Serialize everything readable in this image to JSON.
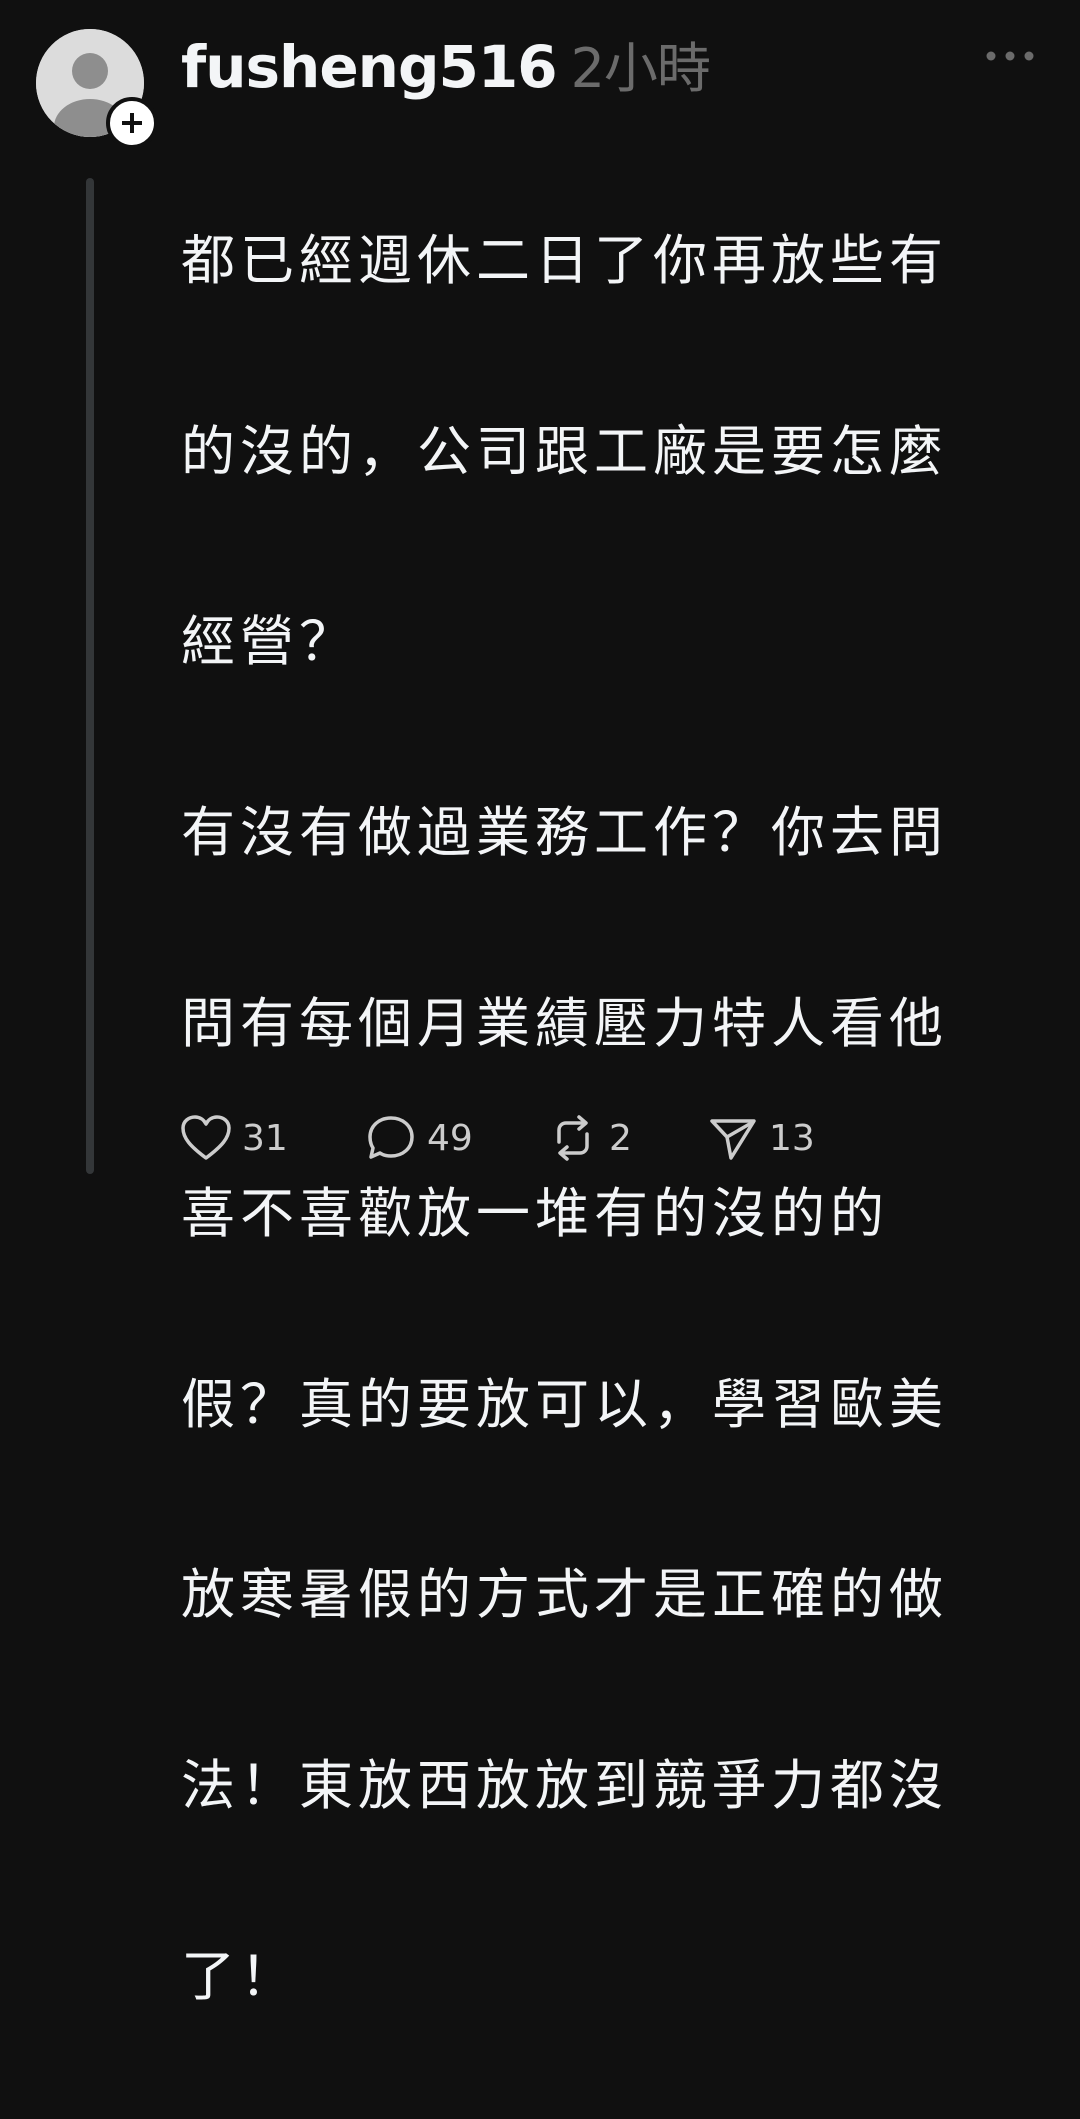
{
  "post": {
    "username": "fusheng516",
    "timestamp": "2小時",
    "body": "都已經週休二日了你再放些有的沒的，公司跟工廠是要怎麼經營？\n有沒有做過業務工作？你去問問有每個月業績壓力特人看他喜不喜歡放一堆有的沒的的假？真的要放可以，學習歐美放寒暑假的方式才是正確的做法！東放西放放到競爭力都沒了！",
    "body_lines": [
      "都已經週休二日了你再放些有",
      "的沒的，公司跟工廠是要怎麼",
      "經營？",
      "有沒有做過業務工作？你去問",
      "問有每個月業績壓力特人看他",
      "喜不喜歡放一堆有的沒的的",
      "假？真的要放可以，學習歐美",
      "放寒暑假的方式才是正確的做",
      "法！東放西放放到競爭力都沒",
      "了！"
    ],
    "actions": {
      "likes": "31",
      "comments": "49",
      "reposts": "2",
      "shares": "13"
    }
  },
  "icons": {
    "avatar": "default-avatar-icon",
    "follow": "plus-icon",
    "more": "more-dots-icon",
    "like": "heart-icon",
    "comment": "comment-bubble-icon",
    "repost": "repost-icon",
    "share": "send-icon"
  },
  "colors": {
    "background": "#101010",
    "text": "#f3f5f7",
    "muted": "#6b6b6b",
    "thread_line": "#333638"
  }
}
